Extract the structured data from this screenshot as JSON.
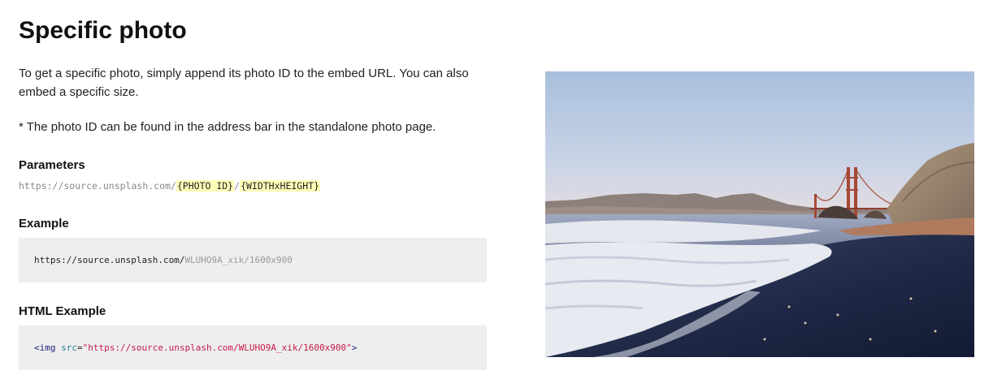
{
  "page": {
    "title": "Specific photo",
    "intro": "To get a specific photo, simply append its photo ID to the embed URL. You can also embed a specific size.",
    "note": "* The photo ID can be found in the address bar in the standalone photo page."
  },
  "parameters": {
    "heading": "Parameters",
    "base": "https://source.unsplash.com/",
    "photo_id_token": "{PHOTO ID}",
    "separator": "/",
    "size_token": "{WIDTHxHEIGHT}"
  },
  "example": {
    "heading": "Example",
    "base": "https://source.unsplash.com/",
    "photo_id": "WLUHO9A_xik",
    "sep": "/",
    "size": "1600x900"
  },
  "html_example": {
    "heading": "HTML Example",
    "open": "<",
    "tag": "img",
    "space": " ",
    "attr": "src",
    "eq": "=",
    "value": "\"https://source.unsplash.com/WLUHO9A_xik/1600x900\"",
    "close": ">"
  },
  "photo": {
    "subject": "golden-gate-bridge-beach-photo"
  },
  "colors": {
    "highlight": "#ffffb8",
    "code_background": "#eeeeee",
    "tag": "#1a237e",
    "attribute": "#2a7f96",
    "string": "#c41a4a"
  }
}
